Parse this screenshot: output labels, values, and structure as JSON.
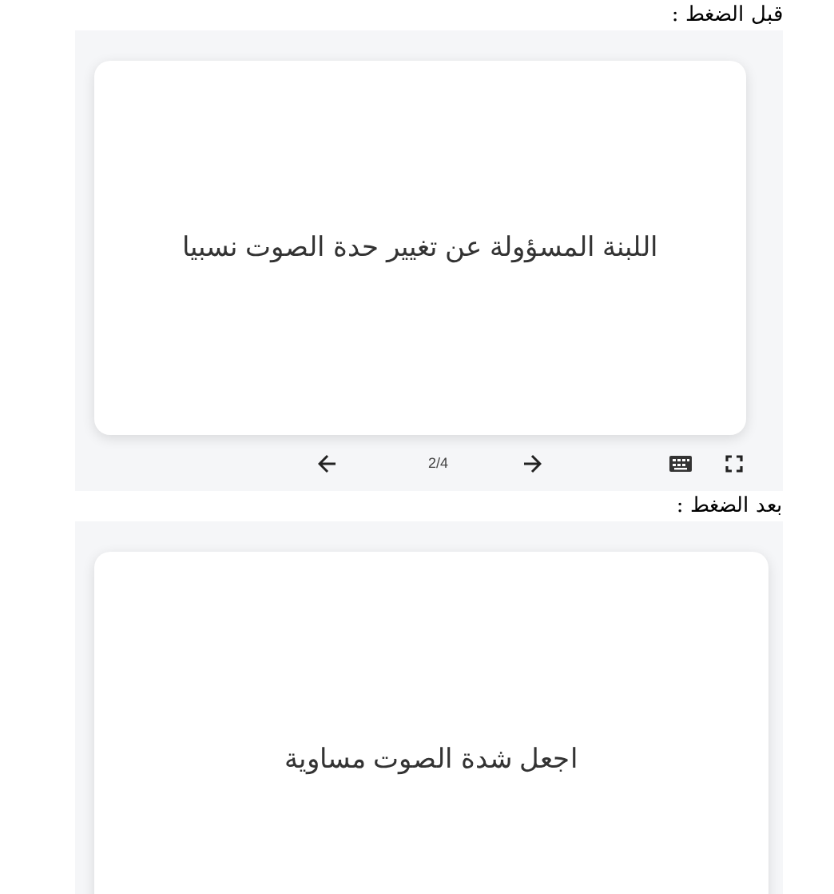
{
  "sections": [
    {
      "label": "قبل الضغط :",
      "card_text": "اللبنة المسؤولة عن تغيير حدة الصوت نسبيا",
      "controls": {
        "counter": "2/4"
      }
    },
    {
      "label": "بعد الضغط :",
      "card_text": "اجعل شدة الصوت مساوية"
    }
  ]
}
